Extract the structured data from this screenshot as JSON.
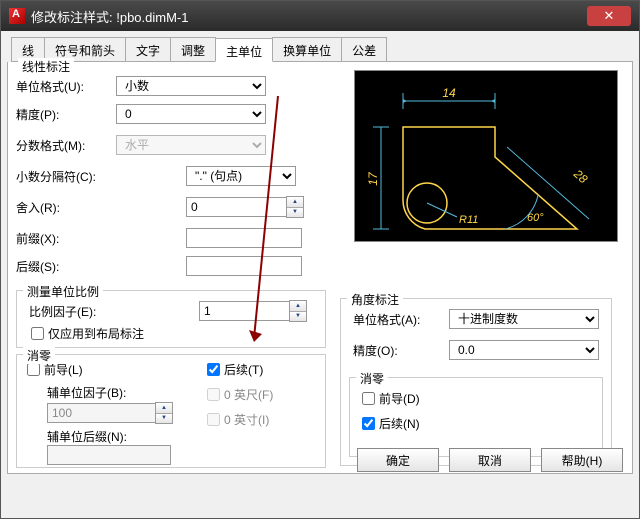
{
  "window": {
    "title": "修改标注样式: !pbo.dimM-1"
  },
  "tabs": [
    "线",
    "符号和箭头",
    "文字",
    "调整",
    "主单位",
    "换算单位",
    "公差"
  ],
  "active_tab_index": 4,
  "linear": {
    "group_label": "线性标注",
    "unit_format": {
      "label": "单位格式(U):",
      "value": "小数"
    },
    "precision": {
      "label": "精度(P):",
      "value": "0"
    },
    "fraction_fmt": {
      "label": "分数格式(M):",
      "value": "水平"
    },
    "decimal_sep": {
      "label": "小数分隔符(C):",
      "value": "\".\"  (句点)"
    },
    "round": {
      "label": "舍入(R):",
      "value": "0"
    },
    "prefix": {
      "label": "前缀(X):",
      "value": ""
    },
    "suffix": {
      "label": "后缀(S):",
      "value": ""
    }
  },
  "scale": {
    "group_label": "测量单位比例",
    "factor": {
      "label": "比例因子(E):",
      "value": "1"
    },
    "layout_only": {
      "label": "仅应用到布局标注",
      "checked": false
    }
  },
  "zero": {
    "group_label": "消零",
    "leading": {
      "label": "前导(L)",
      "checked": false
    },
    "trailing": {
      "label": "后续(T)",
      "checked": true
    },
    "feet": {
      "label": "0 英尺(F)",
      "checked": false
    },
    "inches": {
      "label": "0 英寸(I)",
      "checked": false
    },
    "subfactor": {
      "label": "辅单位因子(B):",
      "value": "100"
    },
    "subsuffix": {
      "label": "辅单位后缀(N):",
      "value": ""
    }
  },
  "angle": {
    "group_label": "角度标注",
    "unit_format": {
      "label": "单位格式(A):",
      "value": "十进制度数"
    },
    "precision": {
      "label": "精度(O):",
      "value": "0.0"
    },
    "zero_group": "消零",
    "leading": {
      "label": "前导(D)",
      "checked": false
    },
    "trailing": {
      "label": "后续(N)",
      "checked": true
    }
  },
  "preview": {
    "dim_h": "14",
    "dim_v": "17",
    "dim_r": "R11",
    "dim_ang": "60°",
    "dim_diag": "28"
  },
  "buttons": {
    "ok": "确定",
    "cancel": "取消",
    "help": "帮助(H)"
  }
}
